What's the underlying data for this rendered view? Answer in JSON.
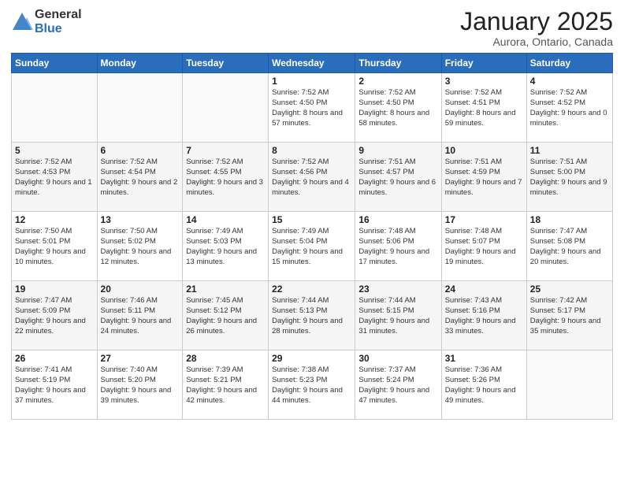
{
  "logo": {
    "general": "General",
    "blue": "Blue"
  },
  "header": {
    "month": "January 2025",
    "location": "Aurora, Ontario, Canada"
  },
  "weekdays": [
    "Sunday",
    "Monday",
    "Tuesday",
    "Wednesday",
    "Thursday",
    "Friday",
    "Saturday"
  ],
  "weeks": [
    [
      {
        "day": "",
        "info": ""
      },
      {
        "day": "",
        "info": ""
      },
      {
        "day": "",
        "info": ""
      },
      {
        "day": "1",
        "info": "Sunrise: 7:52 AM\nSunset: 4:50 PM\nDaylight: 8 hours and 57 minutes."
      },
      {
        "day": "2",
        "info": "Sunrise: 7:52 AM\nSunset: 4:50 PM\nDaylight: 8 hours and 58 minutes."
      },
      {
        "day": "3",
        "info": "Sunrise: 7:52 AM\nSunset: 4:51 PM\nDaylight: 8 hours and 59 minutes."
      },
      {
        "day": "4",
        "info": "Sunrise: 7:52 AM\nSunset: 4:52 PM\nDaylight: 9 hours and 0 minutes."
      }
    ],
    [
      {
        "day": "5",
        "info": "Sunrise: 7:52 AM\nSunset: 4:53 PM\nDaylight: 9 hours and 1 minute."
      },
      {
        "day": "6",
        "info": "Sunrise: 7:52 AM\nSunset: 4:54 PM\nDaylight: 9 hours and 2 minutes."
      },
      {
        "day": "7",
        "info": "Sunrise: 7:52 AM\nSunset: 4:55 PM\nDaylight: 9 hours and 3 minutes."
      },
      {
        "day": "8",
        "info": "Sunrise: 7:52 AM\nSunset: 4:56 PM\nDaylight: 9 hours and 4 minutes."
      },
      {
        "day": "9",
        "info": "Sunrise: 7:51 AM\nSunset: 4:57 PM\nDaylight: 9 hours and 6 minutes."
      },
      {
        "day": "10",
        "info": "Sunrise: 7:51 AM\nSunset: 4:59 PM\nDaylight: 9 hours and 7 minutes."
      },
      {
        "day": "11",
        "info": "Sunrise: 7:51 AM\nSunset: 5:00 PM\nDaylight: 9 hours and 9 minutes."
      }
    ],
    [
      {
        "day": "12",
        "info": "Sunrise: 7:50 AM\nSunset: 5:01 PM\nDaylight: 9 hours and 10 minutes."
      },
      {
        "day": "13",
        "info": "Sunrise: 7:50 AM\nSunset: 5:02 PM\nDaylight: 9 hours and 12 minutes."
      },
      {
        "day": "14",
        "info": "Sunrise: 7:49 AM\nSunset: 5:03 PM\nDaylight: 9 hours and 13 minutes."
      },
      {
        "day": "15",
        "info": "Sunrise: 7:49 AM\nSunset: 5:04 PM\nDaylight: 9 hours and 15 minutes."
      },
      {
        "day": "16",
        "info": "Sunrise: 7:48 AM\nSunset: 5:06 PM\nDaylight: 9 hours and 17 minutes."
      },
      {
        "day": "17",
        "info": "Sunrise: 7:48 AM\nSunset: 5:07 PM\nDaylight: 9 hours and 19 minutes."
      },
      {
        "day": "18",
        "info": "Sunrise: 7:47 AM\nSunset: 5:08 PM\nDaylight: 9 hours and 20 minutes."
      }
    ],
    [
      {
        "day": "19",
        "info": "Sunrise: 7:47 AM\nSunset: 5:09 PM\nDaylight: 9 hours and 22 minutes."
      },
      {
        "day": "20",
        "info": "Sunrise: 7:46 AM\nSunset: 5:11 PM\nDaylight: 9 hours and 24 minutes."
      },
      {
        "day": "21",
        "info": "Sunrise: 7:45 AM\nSunset: 5:12 PM\nDaylight: 9 hours and 26 minutes."
      },
      {
        "day": "22",
        "info": "Sunrise: 7:44 AM\nSunset: 5:13 PM\nDaylight: 9 hours and 28 minutes."
      },
      {
        "day": "23",
        "info": "Sunrise: 7:44 AM\nSunset: 5:15 PM\nDaylight: 9 hours and 31 minutes."
      },
      {
        "day": "24",
        "info": "Sunrise: 7:43 AM\nSunset: 5:16 PM\nDaylight: 9 hours and 33 minutes."
      },
      {
        "day": "25",
        "info": "Sunrise: 7:42 AM\nSunset: 5:17 PM\nDaylight: 9 hours and 35 minutes."
      }
    ],
    [
      {
        "day": "26",
        "info": "Sunrise: 7:41 AM\nSunset: 5:19 PM\nDaylight: 9 hours and 37 minutes."
      },
      {
        "day": "27",
        "info": "Sunrise: 7:40 AM\nSunset: 5:20 PM\nDaylight: 9 hours and 39 minutes."
      },
      {
        "day": "28",
        "info": "Sunrise: 7:39 AM\nSunset: 5:21 PM\nDaylight: 9 hours and 42 minutes."
      },
      {
        "day": "29",
        "info": "Sunrise: 7:38 AM\nSunset: 5:23 PM\nDaylight: 9 hours and 44 minutes."
      },
      {
        "day": "30",
        "info": "Sunrise: 7:37 AM\nSunset: 5:24 PM\nDaylight: 9 hours and 47 minutes."
      },
      {
        "day": "31",
        "info": "Sunrise: 7:36 AM\nSunset: 5:26 PM\nDaylight: 9 hours and 49 minutes."
      },
      {
        "day": "",
        "info": ""
      }
    ]
  ]
}
